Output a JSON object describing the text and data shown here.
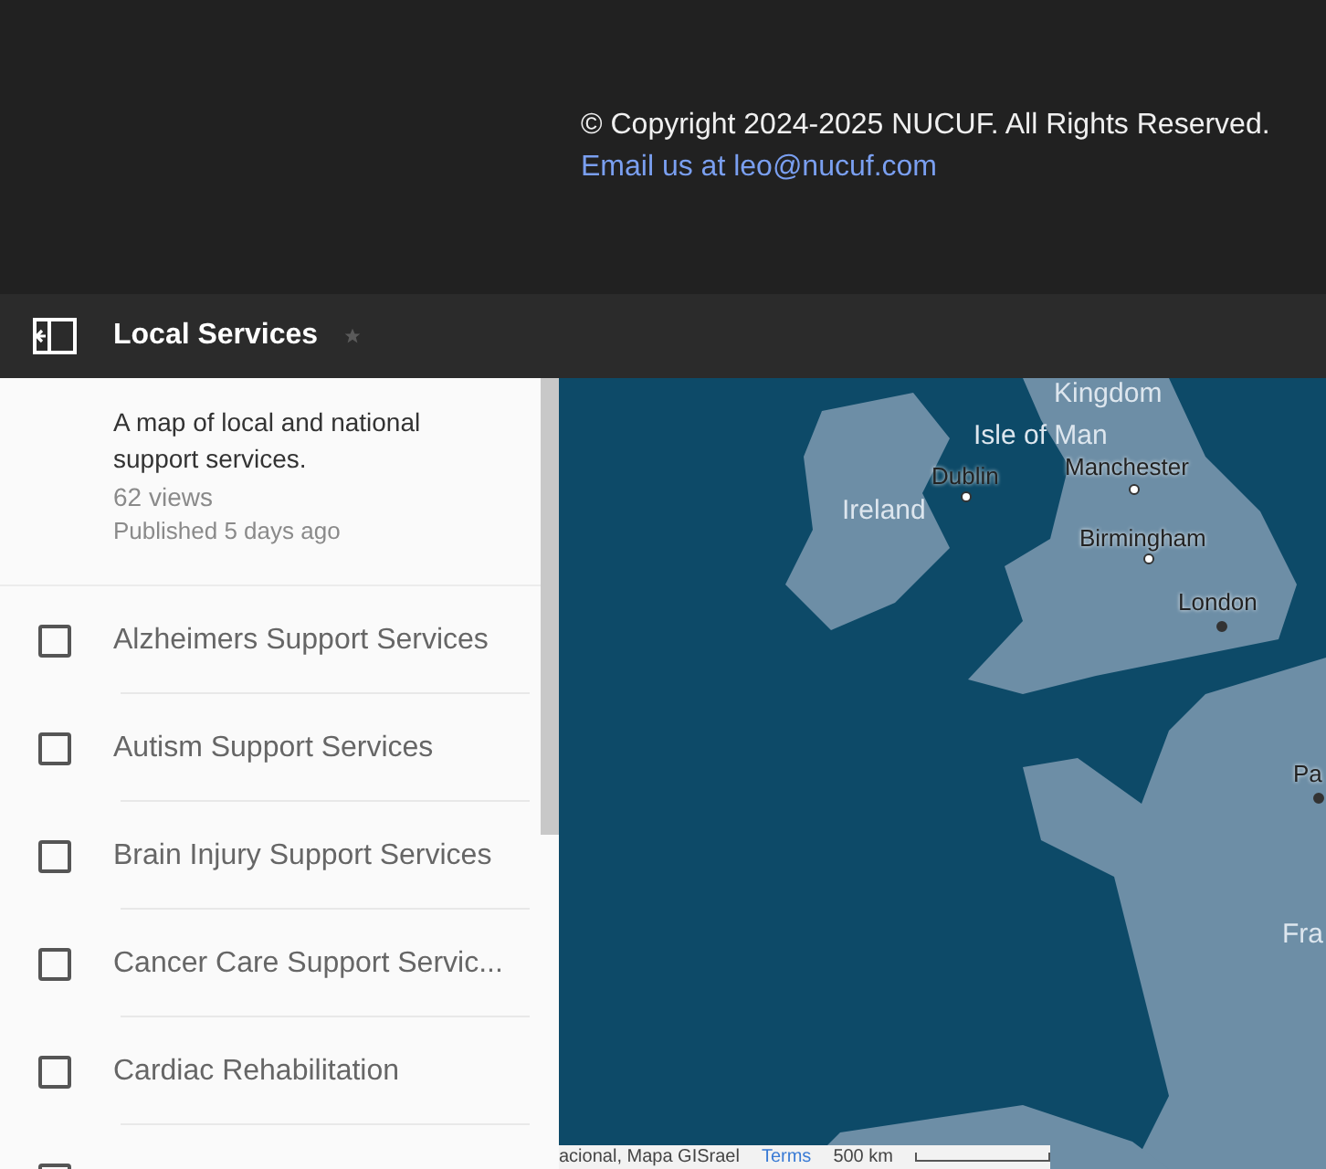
{
  "footer": {
    "copyright": "© Copyright 2024-2025 NUCUF. All Rights Reserved.",
    "email_link": "Email us at leo@nucuf.com"
  },
  "map_header": {
    "title": "Local Services",
    "starred": false
  },
  "sidebar": {
    "description": "A map of local and national support services.",
    "views": "62 views",
    "published": "Published 5 days ago",
    "layers": [
      {
        "label": "Alzheimers Support Services",
        "checked": false
      },
      {
        "label": "Autism Support Services",
        "checked": false
      },
      {
        "label": "Brain Injury Support Services",
        "checked": false
      },
      {
        "label": "Cancer Care Support Servic...",
        "checked": false
      },
      {
        "label": "Cardiac Rehabilitation",
        "checked": false
      },
      {
        "checked": false
      }
    ]
  },
  "map": {
    "labels": [
      {
        "text": "Kingdom",
        "kind": "region"
      },
      {
        "text": "Isle of Man",
        "kind": "region"
      },
      {
        "text": "Dublin",
        "kind": "city"
      },
      {
        "text": "Ireland",
        "kind": "region"
      },
      {
        "text": "Manchester",
        "kind": "city"
      },
      {
        "text": "Birmingham",
        "kind": "city"
      },
      {
        "text": "London",
        "kind": "capital"
      },
      {
        "text": "Pa",
        "kind": "capital"
      },
      {
        "text": "Fra",
        "kind": "region"
      }
    ],
    "attribution": "acional, Mapa GISrael",
    "terms_link": "Terms",
    "scale": "500 km"
  }
}
